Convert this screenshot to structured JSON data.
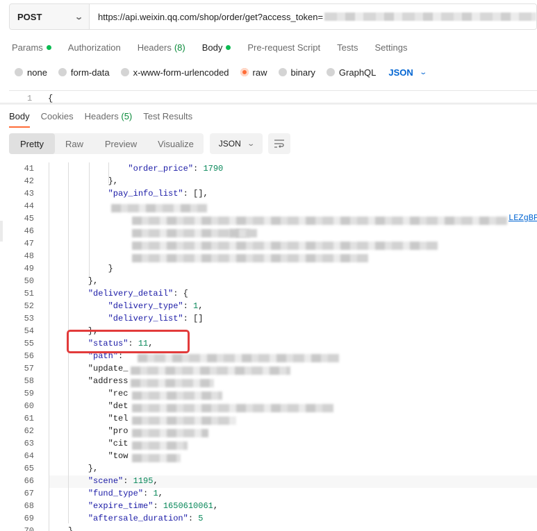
{
  "request": {
    "method": "POST",
    "url": "https://api.weixin.qq.com/shop/order/get?access_token="
  },
  "request_tabs": [
    {
      "label": "Params",
      "dot": true
    },
    {
      "label": "Authorization",
      "dot": false
    },
    {
      "label": "Headers",
      "count": "(8)",
      "dot": false
    },
    {
      "label": "Body",
      "dot": true,
      "active": true
    },
    {
      "label": "Pre-request Script",
      "dot": false
    },
    {
      "label": "Tests",
      "dot": false
    },
    {
      "label": "Settings",
      "dot": false
    }
  ],
  "body_types": [
    "none",
    "form-data",
    "x-www-form-urlencoded",
    "raw",
    "binary",
    "GraphQL"
  ],
  "body_type_selected": "raw",
  "raw_format": "JSON",
  "request_editor": {
    "line": "1",
    "code": "{"
  },
  "response_tabs": [
    {
      "label": "Body",
      "active": true
    },
    {
      "label": "Cookies"
    },
    {
      "label": "Headers",
      "count": "(5)"
    },
    {
      "label": "Test Results"
    }
  ],
  "view_modes": [
    "Pretty",
    "Raw",
    "Preview",
    "Visualize"
  ],
  "view_mode_selected": "Pretty",
  "response_format": "JSON",
  "code_lines": [
    {
      "n": "41",
      "text": "            \"order_price\": 1790"
    },
    {
      "n": "42",
      "text": "        },"
    },
    {
      "n": "43",
      "text": "        \"pay_info_list\": [],"
    },
    {
      "n": "44",
      "text": ""
    },
    {
      "n": "45",
      "text": ""
    },
    {
      "n": "46",
      "text": ""
    },
    {
      "n": "47",
      "text": ""
    },
    {
      "n": "48",
      "text": ""
    },
    {
      "n": "49",
      "text": "        }"
    },
    {
      "n": "50",
      "text": "    },"
    },
    {
      "n": "51",
      "text": "    \"delivery_detail\": {"
    },
    {
      "n": "52",
      "text": "        \"delivery_type\": 1,"
    },
    {
      "n": "53",
      "text": "        \"delivery_list\": []"
    },
    {
      "n": "54",
      "text": "    },"
    },
    {
      "n": "55",
      "text": "    \"status\": 11,"
    },
    {
      "n": "56",
      "text": "    \"path\":"
    },
    {
      "n": "57",
      "text": "    \"update_"
    },
    {
      "n": "58",
      "text": "    \"address"
    },
    {
      "n": "59",
      "text": "        \"rec"
    },
    {
      "n": "60",
      "text": "        \"det"
    },
    {
      "n": "61",
      "text": "        \"tel"
    },
    {
      "n": "62",
      "text": "        \"pro"
    },
    {
      "n": "63",
      "text": "        \"cit"
    },
    {
      "n": "64",
      "text": "        \"tow"
    },
    {
      "n": "65",
      "text": "    },"
    },
    {
      "n": "66",
      "text": "    \"scene\": 1195,"
    },
    {
      "n": "67",
      "text": "    \"fund_type\": 1,"
    },
    {
      "n": "68",
      "text": "    \"expire_time\": 1650610061,"
    },
    {
      "n": "69",
      "text": "    \"aftersale_duration\": 5"
    },
    {
      "n": "70",
      "text": "}"
    }
  ],
  "link_fragment": "LEZgBP",
  "colors": {
    "accent": "#ff6c37",
    "green_dot": "#0cbb52",
    "link_blue": "#0265d2",
    "highlight_red": "#e23b3b"
  }
}
